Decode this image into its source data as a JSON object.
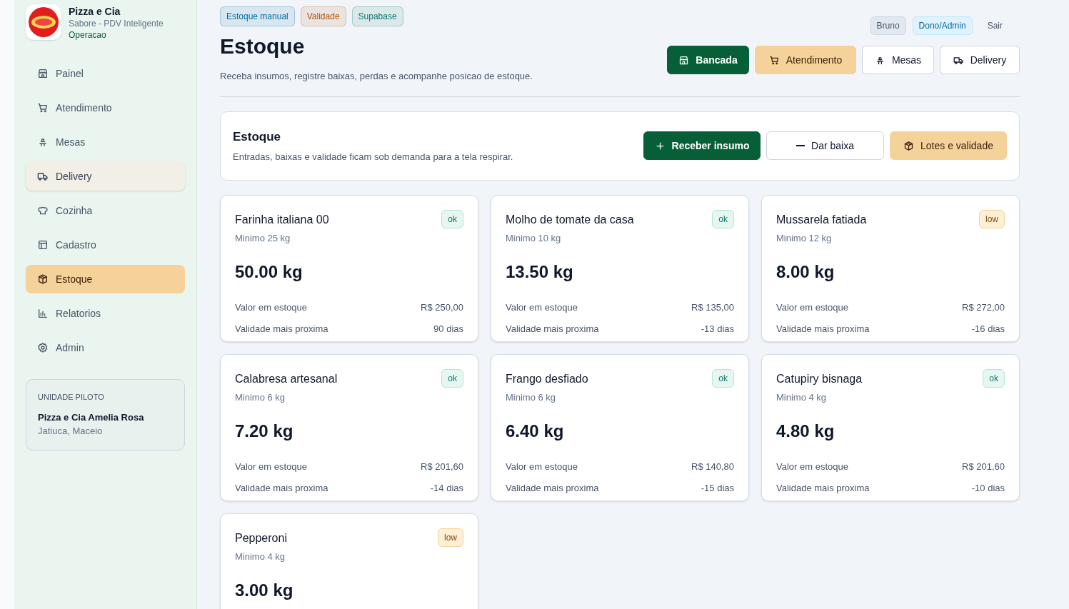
{
  "brand": {
    "name": "Pizza e Cia",
    "subtitle": "Sabore - PDV Inteligente",
    "section": "Operacao"
  },
  "sidebar": {
    "items": [
      {
        "label": "Painel",
        "selected": false,
        "hovered": false
      },
      {
        "label": "Atendimento",
        "selected": false,
        "hovered": false
      },
      {
        "label": "Mesas",
        "selected": false,
        "hovered": false
      },
      {
        "label": "Delivery",
        "selected": false,
        "hovered": true
      },
      {
        "label": "Cozinha",
        "selected": false,
        "hovered": false
      },
      {
        "label": "Cadastro",
        "selected": false,
        "hovered": false
      },
      {
        "label": "Estoque",
        "selected": true,
        "hovered": false
      },
      {
        "label": "Relatorios",
        "selected": false,
        "hovered": false
      },
      {
        "label": "Admin",
        "selected": false,
        "hovered": false
      }
    ],
    "unit": {
      "caption": "UNIDADE PILOTO",
      "name": "Pizza e Cia Amelia Rosa",
      "location": "Jatiuca, Maceio"
    }
  },
  "header": {
    "tags": [
      {
        "label": "Estoque manual",
        "color": "#0369a1"
      },
      {
        "label": "Validade",
        "color": "#b45309"
      },
      {
        "label": "Supabase",
        "color": "#0f766e"
      }
    ],
    "title": "Estoque",
    "description": "Receba insumos, registre baixas, perdas e acompanhe posicao de estoque.",
    "user": {
      "name": "Bruno",
      "role": "Dono/Admin",
      "logout": "Sair"
    },
    "actions": [
      {
        "label": "Bancada",
        "kind": "primary"
      },
      {
        "label": "Atendimento",
        "kind": "accent"
      },
      {
        "label": "Mesas",
        "kind": "outline"
      },
      {
        "label": "Delivery",
        "kind": "outline"
      }
    ]
  },
  "panel": {
    "title": "Estoque",
    "description": "Entradas, baixas e validade ficam sob demanda para a tela respirar.",
    "actions": [
      {
        "label": "Receber insumo",
        "kind": "primary"
      },
      {
        "label": "Dar baixa",
        "kind": "outline"
      },
      {
        "label": "Lotes e validade",
        "kind": "accent"
      }
    ]
  },
  "items": [
    {
      "name": "Farinha italiana 00",
      "status": "ok",
      "low_stock": false,
      "minimum": "Minimo 25 kg",
      "quantity": "50.00 kg",
      "value_label": "Valor em estoque",
      "value": "R$ 250,00",
      "expiry_label": "Validade mais proxima",
      "expiry": "90 dias"
    },
    {
      "name": "Molho de tomate da casa",
      "status": "ok",
      "low_stock": false,
      "minimum": "Minimo 10 kg",
      "quantity": "13.50 kg",
      "value_label": "Valor em estoque",
      "value": "R$ 135,00",
      "expiry_label": "Validade mais proxima",
      "expiry": "-13 dias"
    },
    {
      "name": "Mussarela fatiada",
      "status": "low",
      "low_stock": true,
      "minimum": "Minimo 12 kg",
      "quantity": "8.00 kg",
      "value_label": "Valor em estoque",
      "value": "R$ 272,00",
      "expiry_label": "Validade mais proxima",
      "expiry": "-16 dias"
    },
    {
      "name": "Calabresa artesanal",
      "status": "ok",
      "low_stock": false,
      "minimum": "Minimo 6 kg",
      "quantity": "7.20 kg",
      "value_label": "Valor em estoque",
      "value": "R$ 201,60",
      "expiry_label": "Validade mais proxima",
      "expiry": "-14 dias"
    },
    {
      "name": "Frango desfiado",
      "status": "ok",
      "low_stock": false,
      "minimum": "Minimo 6 kg",
      "quantity": "6.40 kg",
      "value_label": "Valor em estoque",
      "value": "R$ 140,80",
      "expiry_label": "Validade mais proxima",
      "expiry": "-15 dias"
    },
    {
      "name": "Catupiry bisnaga",
      "status": "ok",
      "low_stock": false,
      "minimum": "Minimo 4 kg",
      "quantity": "4.80 kg",
      "value_label": "Valor em estoque",
      "value": "R$ 201,60",
      "expiry_label": "Validade mais proxima",
      "expiry": "-10 dias"
    },
    {
      "name": "Pepperoni",
      "status": "low",
      "low_stock": true,
      "minimum": "Minimo 4 kg",
      "quantity": "3.00 kg"
    }
  ]
}
